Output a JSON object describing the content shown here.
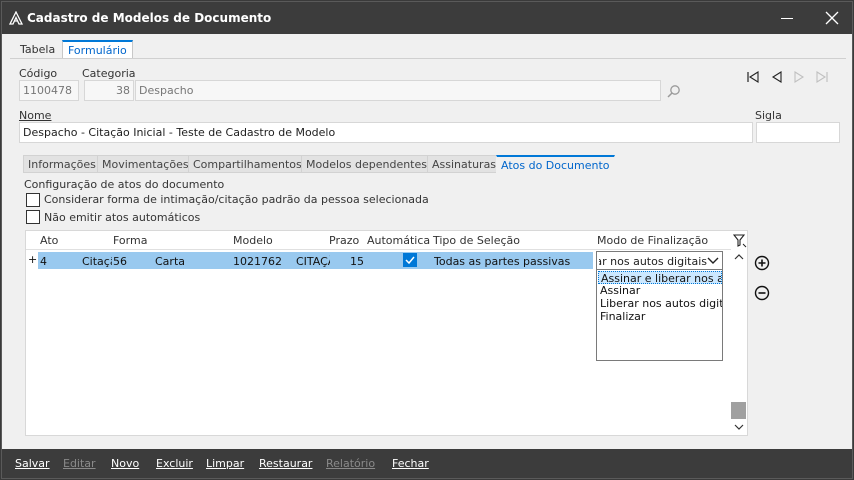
{
  "window": {
    "title": "Cadastro de Modelos de Documento"
  },
  "top_tabs": [
    {
      "label": "Tabela",
      "active": false
    },
    {
      "label": "Formulário",
      "active": true
    }
  ],
  "form": {
    "codigo_label": "Código",
    "codigo_value": "1100478",
    "categoria_label": "Categoria",
    "categoria_code": "38",
    "categoria_name": "Despacho",
    "nome_label": "Nome",
    "nome_value": "Despacho - Citação Inicial - Teste de Cadastro de Modelo",
    "sigla_label": "Sigla",
    "sigla_value": ""
  },
  "inner_tabs": [
    {
      "label": "Informações",
      "active": false
    },
    {
      "label": "Movimentações",
      "active": false
    },
    {
      "label": "Compartilhamentos",
      "active": false
    },
    {
      "label": "Modelos dependentes",
      "active": false
    },
    {
      "label": "Assinaturas",
      "active": false
    },
    {
      "label": "Atos do Documento",
      "active": true
    }
  ],
  "atos": {
    "section_title": "Configuração de atos do documento",
    "checkbox1_label": "Considerar forma de intimação/citação padrão da pessoa selecionada",
    "checkbox1_checked": false,
    "checkbox2_label": "Não emitir atos automáticos",
    "checkbox2_checked": false
  },
  "grid": {
    "columns": [
      "Ato",
      "Forma",
      "Modelo",
      "Prazo",
      "Automática",
      "Tipo de Seleção",
      "Modo de Finalização"
    ],
    "rows": [
      {
        "marker": "+",
        "ato": "4",
        "ato_desc": "Citação",
        "forma_code": "56",
        "forma_desc": "Carta",
        "modelo_code": "1021762",
        "modelo_desc": "CITAÇÃO",
        "prazo": "15",
        "automatica": true,
        "tipo_selecao": "Todas as partes passivas",
        "modo_finalizacao": "Assinar e liberar nos autos digitais"
      }
    ],
    "dropdown_options": [
      "Assinar e liberar nos autos digitais",
      "Assinar",
      "Liberar nos autos digitais",
      "Finalizar"
    ],
    "dropdown_selected_index": 0,
    "scroll_position": 0.93
  },
  "side_buttons": {
    "add_icon": "plus-circle-icon",
    "remove_icon": "minus-circle-icon"
  },
  "bottom_bar": {
    "buttons": [
      {
        "label": "Salvar",
        "enabled": true
      },
      {
        "label": "Editar",
        "enabled": false
      },
      {
        "label": "Novo",
        "enabled": true
      },
      {
        "label": "Excluir",
        "enabled": true
      },
      {
        "label": "Limpar",
        "enabled": true
      },
      {
        "label": "Restaurar",
        "enabled": true
      },
      {
        "label": "Relatório",
        "enabled": false
      },
      {
        "label": "Fechar",
        "enabled": true
      }
    ]
  },
  "colors": {
    "titlebar_bg": "#3c3c3c",
    "accent": "#0078d7",
    "selected_row": "#99c9ef",
    "link_text": "#0066cc"
  }
}
